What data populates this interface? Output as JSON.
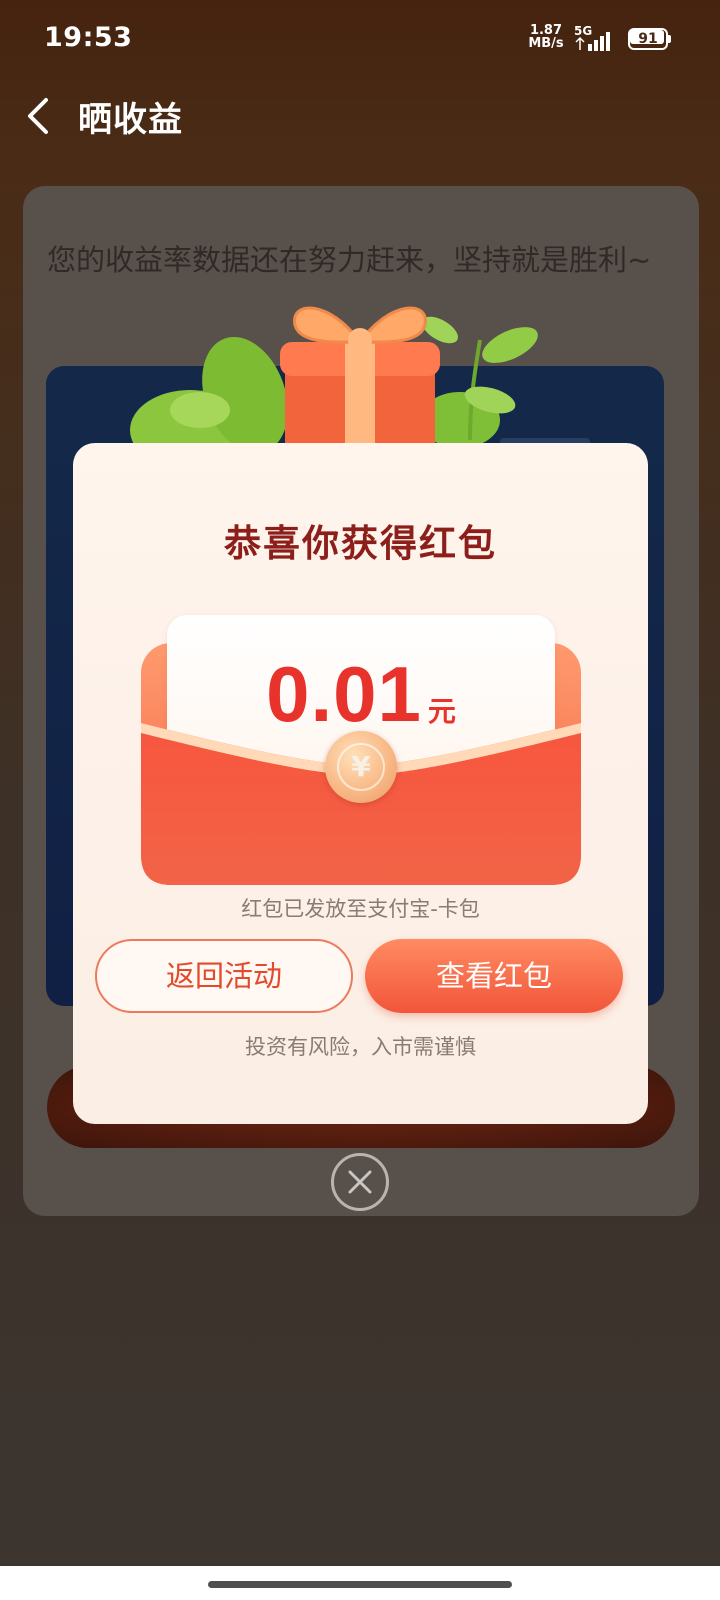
{
  "status_bar": {
    "time": "19:53",
    "net_speed_value": "1.87",
    "net_speed_unit": "MB/s",
    "network_type": "5G",
    "battery_level": "91"
  },
  "header": {
    "title": "晒收益"
  },
  "background": {
    "message": "您的收益率数据还在努力赶来，坚持就是胜利~"
  },
  "modal": {
    "title": "恭喜你获得红包",
    "amount": "0.01",
    "amount_unit": "元",
    "seal_symbol": "¥",
    "notice": "红包已发放至支付宝-卡包",
    "return_button": "返回活动",
    "view_button": "查看红包",
    "risk_warning": "投资有风险，入市需谨慎"
  },
  "colors": {
    "accent": "#f2553a",
    "title_red": "#8c1f1a",
    "amount_red": "#e8332c"
  }
}
